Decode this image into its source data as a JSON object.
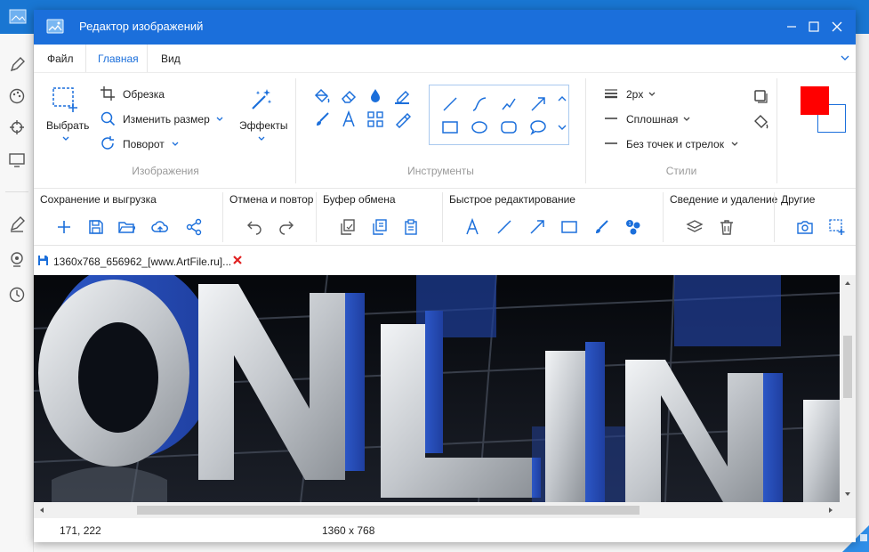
{
  "window": {
    "title": "Редактор изображений"
  },
  "menu": {
    "file": "Файл",
    "home": "Главная",
    "view": "Вид"
  },
  "ribbon": {
    "select_label": "Выбрать",
    "crop_label": "Обрезка",
    "resize_label": "Изменить размер",
    "rotate_label": "Поворот",
    "effects_label": "Эффекты",
    "images_group": "Изображения",
    "tools_group": "Инструменты",
    "stroke_width": "2px",
    "line_style": "Сплошная",
    "line_ends": "Без точек и стрелок",
    "styles_group": "Стили",
    "primary_color": "#ff0000",
    "secondary_color": "#ffffff"
  },
  "quickbar": {
    "save_export": "Сохранение и выгрузка",
    "undo_redo": "Отмена и повтор",
    "clipboard": "Буфер обмена",
    "quick_edit": "Быстрое редактирование",
    "merge_delete": "Сведение и удаление",
    "other": "Другие"
  },
  "document": {
    "tab_title": "1360x768_656962_[www.ArtFile.ru]...",
    "close_icon": "close-icon"
  },
  "status": {
    "cursor_position": "171, 222",
    "image_size": "1360 x 768"
  },
  "colors": {
    "accent": "#1b6fdb",
    "close_red": "#e02020"
  }
}
